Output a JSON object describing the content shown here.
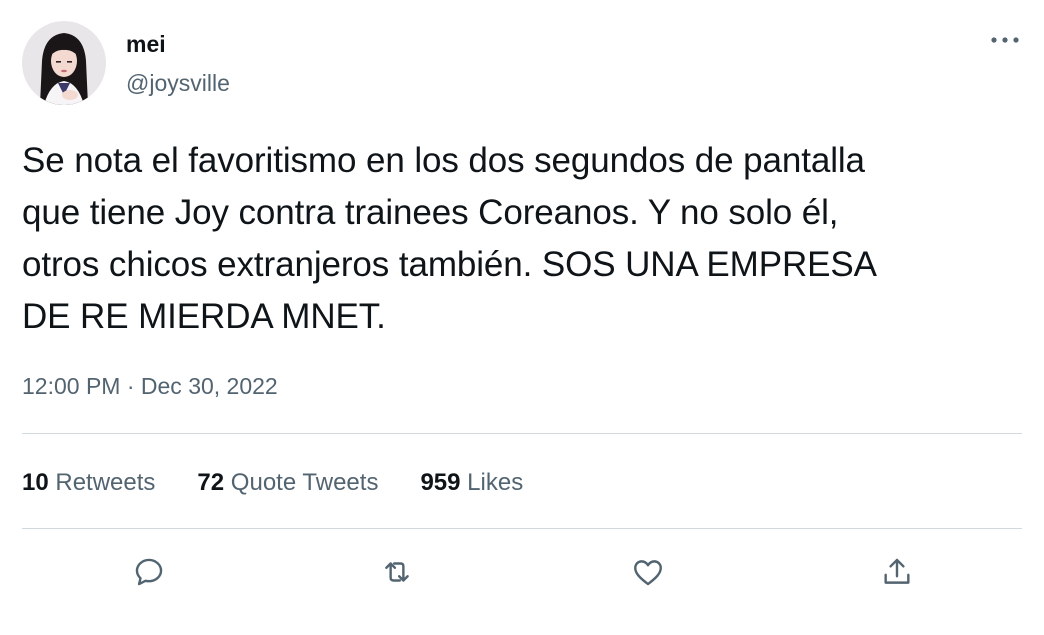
{
  "author": {
    "display_name": "mei",
    "handle": "@joysville"
  },
  "tweet": {
    "text": "Se nota el favoritismo en los dos segundos de pantalla\nque tiene Joy contra trainees Coreanos. Y no solo él,\notros chicos extranjeros también. SOS UNA EMPRESA\nDE RE MIERDA MNET.",
    "time": "12:00 PM",
    "separator": "·",
    "date": "Dec 30, 2022"
  },
  "stats": {
    "retweets_count": "10",
    "retweets_label": "Retweets",
    "quotes_count": "72",
    "quotes_label": "Quote Tweets",
    "likes_count": "959",
    "likes_label": "Likes"
  },
  "icons": {
    "more": "more-horizontal-icon",
    "reply": "reply-icon",
    "retweet": "retweet-icon",
    "like": "heart-icon",
    "share": "share-icon"
  },
  "colors": {
    "text_primary": "#0f1419",
    "text_secondary": "#536471",
    "divider": "#cfd9de"
  }
}
